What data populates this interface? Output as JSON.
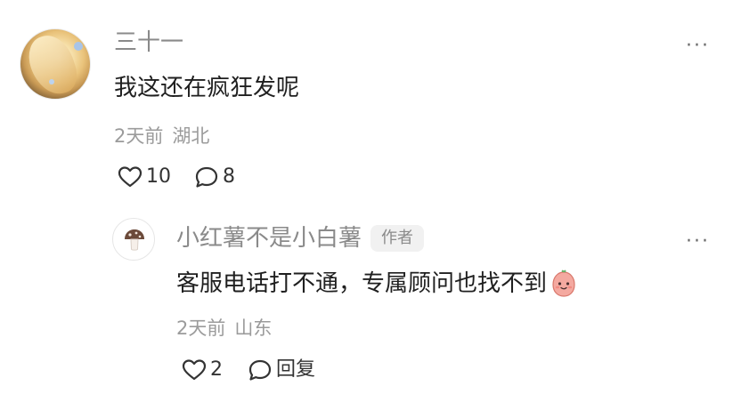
{
  "comment": {
    "username": "三十一",
    "text": "我这还在疯狂发呢",
    "time": "2天前",
    "location": "湖北",
    "likes": "10",
    "replies": "8"
  },
  "reply": {
    "username": "小红薯不是小白薯",
    "badge": "作者",
    "text": "客服电话打不通，专属顾问也找不到",
    "time": "2天前",
    "location": "山东",
    "likes": "2",
    "reply_label": "回复"
  },
  "more_symbol": "···"
}
